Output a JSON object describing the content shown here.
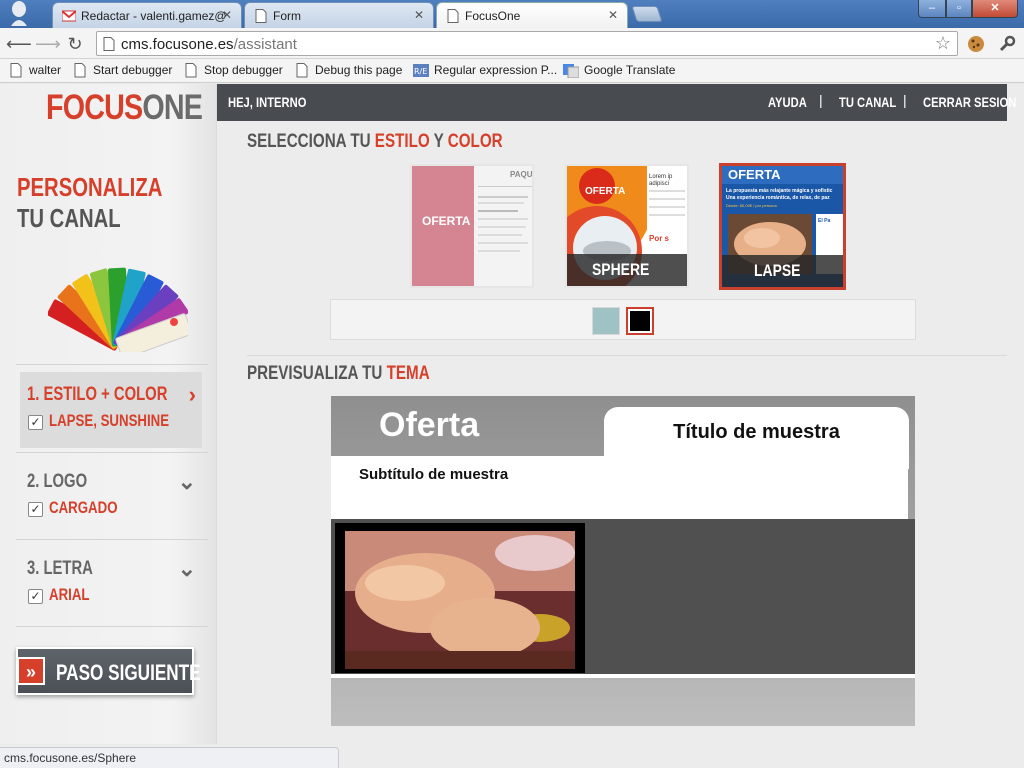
{
  "browser": {
    "tabs": [
      {
        "label": "Redactar - valenti.gamez@",
        "icon": "gmail-icon"
      },
      {
        "label": "Form",
        "icon": "page-icon"
      },
      {
        "label": "FocusOne",
        "icon": "page-icon"
      }
    ],
    "close_glyph": "✕",
    "url_host": "cms.focusone.es",
    "url_path": "/assistant",
    "bookmarks": [
      "walter",
      "Start debugger",
      "Stop debugger",
      "Debug this page",
      "Regular expression P...",
      "Google Translate"
    ],
    "status_text": "cms.focusone.es/Sphere"
  },
  "site": {
    "logo_focus": "FOCUS",
    "logo_one": "ONE",
    "greeting": "HEJ, INTERNO",
    "nav": [
      "AYUDA",
      "TU CANAL",
      "CERRAR SESION"
    ],
    "nav_separator": "|"
  },
  "sidebar": {
    "heading_line1": "PERSONALIZA",
    "heading_line2": "TU CANAL",
    "steps": [
      {
        "title": "1. ESTILO + COLOR",
        "value": "LAPSE, SUNSHINE",
        "chevron": "›"
      },
      {
        "title": "2. LOGO",
        "value": "CARGADO",
        "chevron": "⌄"
      },
      {
        "title": "3. LETRA",
        "value": "ARIAL",
        "chevron": "⌄"
      }
    ],
    "check_glyph": "✓",
    "next_button": {
      "arrows": "»",
      "label": "PASO SIGUIENTE"
    }
  },
  "main": {
    "select_title_a": "SELECCIONA TU ",
    "select_title_b": "ESTILO",
    "select_title_c": " Y ",
    "select_title_d": "COLOR",
    "themes": [
      {
        "name": "",
        "thumb_text": "OFERTA",
        "thumb_header": "PAQUI"
      },
      {
        "name": "SPHERE",
        "thumb_text": "OFERTA",
        "thumb_header": "Lorem ip adipisci",
        "thumb_side": "Por s"
      },
      {
        "name": "LAPSE",
        "thumb_text": "OFERTA",
        "thumb_header": "La propuesta más relajante mágica y sofistic",
        "thumb_line2": "Una experiencia romántica, de relax, de paz",
        "thumb_price": "Desde: 80,00€ / por persona",
        "thumb_side": "El Pa"
      }
    ],
    "swatch_colors": [
      "#9fc3c5",
      "#000000"
    ],
    "selected_swatch": 1,
    "preview_title_a": "PREVISUALIZA TU ",
    "preview_title_b": "TEMA",
    "preview": {
      "oferta": "Oferta",
      "title": "Título de muestra",
      "subtitle": "Subtítulo de muestra"
    }
  },
  "colors": {
    "accent": "#d6402b",
    "topbar": "#484c51",
    "gray_text": "#555555"
  }
}
